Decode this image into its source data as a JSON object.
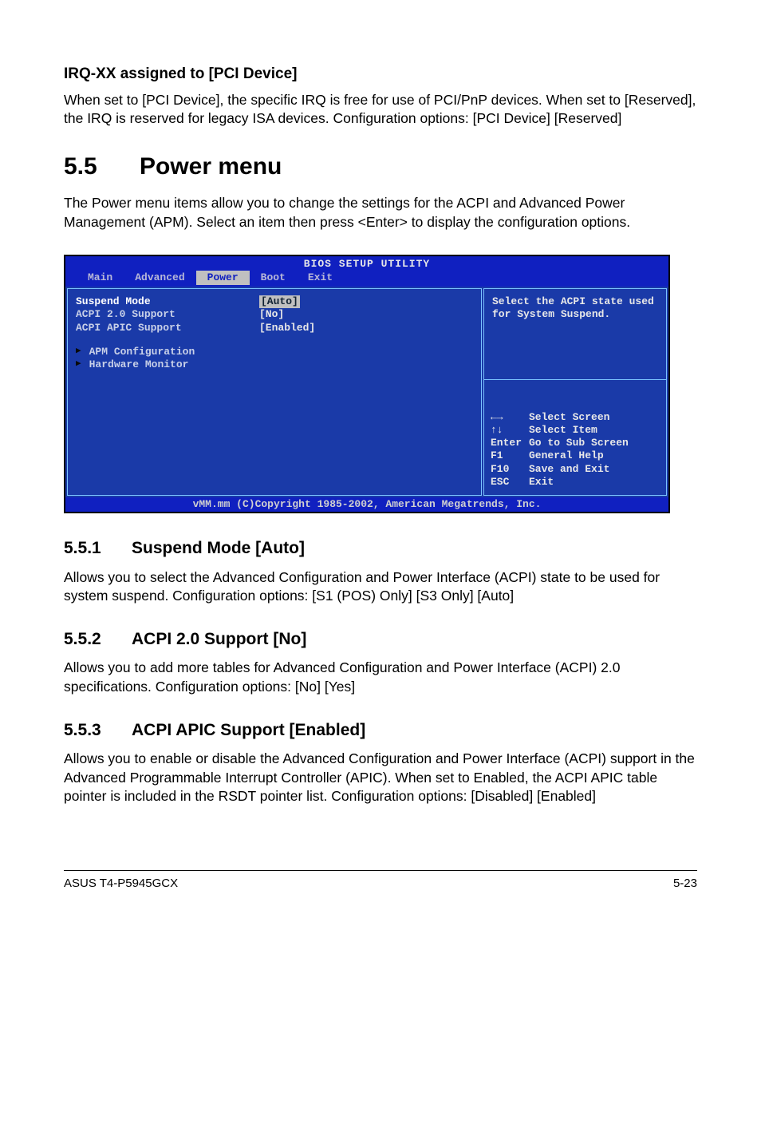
{
  "section_irq": {
    "heading": "IRQ-XX assigned to [PCI Device]",
    "body": "When set to [PCI Device], the specific IRQ is free for use of PCI/PnP devices. When set to [Reserved], the IRQ is reserved for legacy ISA devices. Configuration options: [PCI Device] [Reserved]"
  },
  "section_power": {
    "num": "5.5",
    "title": "Power menu",
    "intro": "The Power menu items allow you to change the settings for the ACPI and Advanced Power Management (APM). Select an item then press <Enter> to display the configuration options."
  },
  "bios": {
    "title": "BIOS SETUP UTILITY",
    "tabs": [
      "Main",
      "Advanced",
      "Power",
      "Boot",
      "Exit"
    ],
    "active_tab": "Power",
    "items": [
      {
        "label": "Suspend Mode",
        "value": "[Auto]",
        "highlight": true
      },
      {
        "label": "ACPI 2.0 Support",
        "value": "[No]"
      },
      {
        "label": "ACPI APIC Support",
        "value": "[Enabled]"
      }
    ],
    "submenus": [
      "APM Configuration",
      "Hardware Monitor"
    ],
    "help": "Select the ACPI state used for System Suspend.",
    "keys": [
      {
        "k": "←→",
        "d": "Select Screen"
      },
      {
        "k": "↑↓",
        "d": "Select Item"
      },
      {
        "k": "Enter",
        "d": "Go to Sub Screen"
      },
      {
        "k": "F1",
        "d": "General Help"
      },
      {
        "k": "F10",
        "d": "Save and Exit"
      },
      {
        "k": "ESC",
        "d": "Exit"
      }
    ],
    "footer": "vMM.mm (C)Copyright 1985-2002, American Megatrends, Inc."
  },
  "sub_551": {
    "num": "5.5.1",
    "title": "Suspend Mode [Auto]",
    "body": "Allows you to select the Advanced Configuration and Power Interface (ACPI) state to be used for system suspend.  Configuration options: [S1 (POS) Only] [S3 Only] [Auto]"
  },
  "sub_552": {
    "num": "5.5.2",
    "title": "ACPI 2.0 Support [No]",
    "body": "Allows you to add more tables for Advanced Configuration and Power Interface (ACPI) 2.0 specifications. Configuration options: [No] [Yes]"
  },
  "sub_553": {
    "num": "5.5.3",
    "title": "ACPI APIC Support [Enabled]",
    "body": "Allows you to enable or disable the Advanced Configuration and Power Interface (ACPI) support in the Advanced Programmable Interrupt Controller (APIC). When set to Enabled, the ACPI APIC table pointer is included in the RSDT pointer list. Configuration options: [Disabled] [Enabled]"
  },
  "footer": {
    "left": "ASUS T4-P5945GCX",
    "right": "5-23"
  }
}
